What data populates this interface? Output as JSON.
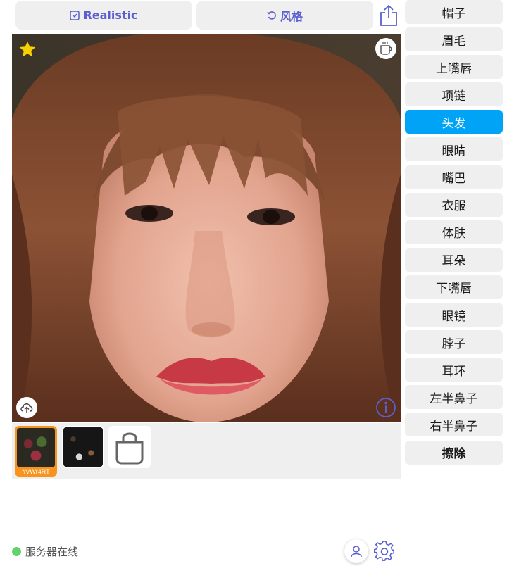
{
  "toolbar": {
    "realistic_label": "Realistic",
    "style_label": "风格",
    "accent_color": "#5b5fd0"
  },
  "part_list": {
    "items": [
      "帽子",
      "眉毛",
      "上嘴唇",
      "项链",
      "头发",
      "眼睛",
      "嘴巴",
      "衣服",
      "体肤",
      "耳朵",
      "下嘴唇",
      "眼镜",
      "脖子",
      "耳环",
      "左半鼻子",
      "右半鼻子"
    ],
    "selected": "头发",
    "erase_label": "擦除",
    "active_color": "#00a3f5"
  },
  "thumbnails": [
    {
      "label": "#VWr4RT",
      "selected": true
    },
    {
      "label": "",
      "selected": false
    }
  ],
  "icons": {
    "favorite": "star-icon",
    "coffee": "coffee-cup-icon",
    "upload": "cloud-upload-icon",
    "info": "info-icon",
    "share": "share-icon",
    "add": "shopping-bag-icon",
    "user": "user-icon",
    "settings": "gear-icon"
  },
  "status": {
    "text": "服务器在线",
    "color": "#62d36b"
  }
}
